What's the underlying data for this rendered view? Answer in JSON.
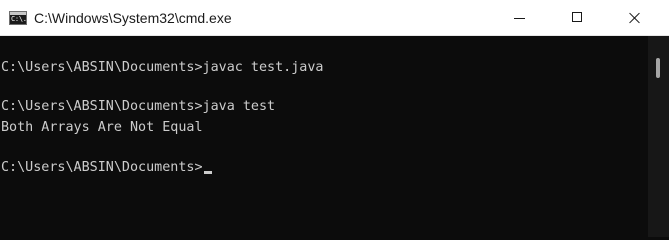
{
  "window": {
    "title": "C:\\Windows\\System32\\cmd.exe",
    "icon": "cmd-icon",
    "icon_text": "C:\\.",
    "controls": {
      "minimize_icon": "minimize-icon",
      "maximize_icon": "maximize-icon",
      "close_icon": "close-icon"
    }
  },
  "console": {
    "lines": [
      "C:\\Users\\ABSIN\\Documents>javac test.java",
      "C:\\Users\\ABSIN\\Documents>java test",
      "Both Arrays Are Not Equal",
      "C:\\Users\\ABSIN\\Documents>"
    ]
  },
  "colors": {
    "console_background": "#0c0c0c",
    "console_text": "#cccccc",
    "titlebar_background": "#ffffff"
  }
}
